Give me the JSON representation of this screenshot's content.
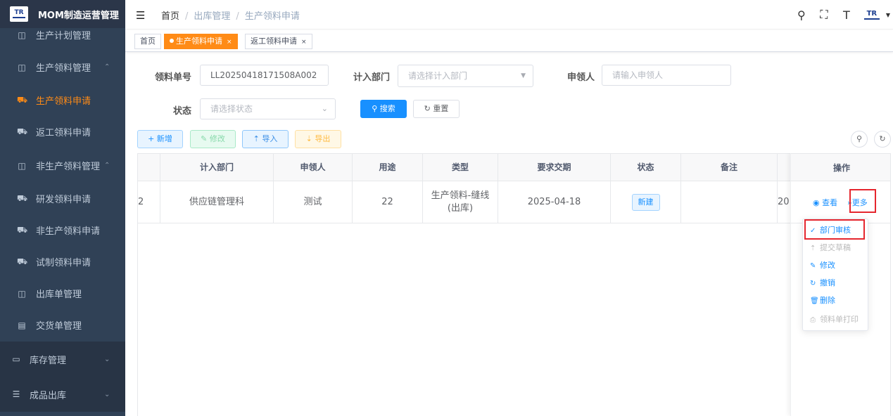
{
  "app": {
    "title": "MOM制造运营管理",
    "logo_text": "TR"
  },
  "sidebar": {
    "items": [
      {
        "label": "生产计划管理",
        "icon": "book-icon",
        "glyph": "◫",
        "arrow": ""
      },
      {
        "label": "生产领料管理",
        "icon": "book-icon",
        "glyph": "◫",
        "arrow": "⌃"
      },
      {
        "label": "生产领料申请",
        "icon": "cart-icon",
        "glyph": "⛟",
        "arrow": ""
      },
      {
        "label": "返工领料申请",
        "icon": "cart-icon",
        "glyph": "⛟",
        "arrow": ""
      },
      {
        "label": "非生产领料管理",
        "icon": "book-icon",
        "glyph": "◫",
        "arrow": "⌃"
      },
      {
        "label": "研发领料申请",
        "icon": "cart-icon",
        "glyph": "⛟",
        "arrow": ""
      },
      {
        "label": "非生产领料申请",
        "icon": "cart-icon",
        "glyph": "⛟",
        "arrow": ""
      },
      {
        "label": "试制领料申请",
        "icon": "cart-icon",
        "glyph": "⛟",
        "arrow": ""
      },
      {
        "label": "出库单管理",
        "icon": "book-icon",
        "glyph": "◫",
        "arrow": ""
      },
      {
        "label": "交货单管理",
        "icon": "calendar-icon",
        "glyph": "▤",
        "arrow": ""
      },
      {
        "label": "库存管理",
        "icon": "monitor-icon",
        "glyph": "▭",
        "arrow": "⌄"
      },
      {
        "label": "成品出库",
        "icon": "list-icon",
        "glyph": "☰",
        "arrow": "⌄"
      }
    ]
  },
  "navbar": {
    "breadcrumb": [
      "首页",
      "出库管理",
      "生产领料申请"
    ],
    "separator": "/",
    "tools": {
      "search": "⚲",
      "fullscreen": "⛶",
      "size": "T"
    }
  },
  "tags": [
    {
      "label": "首页",
      "active": false
    },
    {
      "label": "生产领料申请",
      "active": true,
      "close": "×"
    },
    {
      "label": "返工领料申请",
      "active": false,
      "close": "×"
    }
  ],
  "search": {
    "order_no": {
      "label": "领料单号",
      "value": "LL20250418171508A002"
    },
    "dept": {
      "label": "计入部门",
      "placeholder": "请选择计入部门"
    },
    "applicant": {
      "label": "申领人",
      "placeholder": "请输入申领人"
    },
    "status": {
      "label": "状态",
      "placeholder": "请选择状态"
    },
    "search_btn": "搜索",
    "reset_btn": "重置"
  },
  "toolbar": {
    "add": "新增",
    "edit": "修改",
    "import": "导入",
    "export": "导出"
  },
  "table": {
    "columns": [
      "计入部门",
      "申领人",
      "用途",
      "类型",
      "要求交期",
      "状态",
      "备注",
      "操作"
    ],
    "rows": [
      {
        "cut_left": "2",
        "dept": "供应链管理科",
        "applicant": "测试",
        "purpose": "22",
        "type_line1": "生产领料-缝线",
        "type_line2": "(出库)",
        "due_date": "2025-04-18",
        "status": "新建",
        "remark": "",
        "cut_right": "20"
      }
    ],
    "actions": {
      "view": "查看",
      "more": "更多"
    }
  },
  "dropdown": {
    "items": [
      {
        "label": "部门审核",
        "icon": "check-icon",
        "glyph": "✓",
        "disabled": false
      },
      {
        "label": "提交草稿",
        "icon": "upload-icon",
        "glyph": "⇡",
        "disabled": true
      },
      {
        "label": "修改",
        "icon": "edit-icon",
        "glyph": "✎",
        "disabled": false
      },
      {
        "label": "撤销",
        "icon": "undo-icon",
        "glyph": "↻",
        "disabled": false
      },
      {
        "label": "删除",
        "icon": "delete-icon",
        "glyph": "🗑",
        "disabled": false
      },
      {
        "label": "领料单打印",
        "icon": "print-icon",
        "glyph": "⎙",
        "disabled": true
      }
    ]
  },
  "colors": {
    "sidebar_bg": "#304156",
    "accent": "#ff8b16",
    "primary": "#1890ff",
    "highlight": "#e5262e"
  }
}
